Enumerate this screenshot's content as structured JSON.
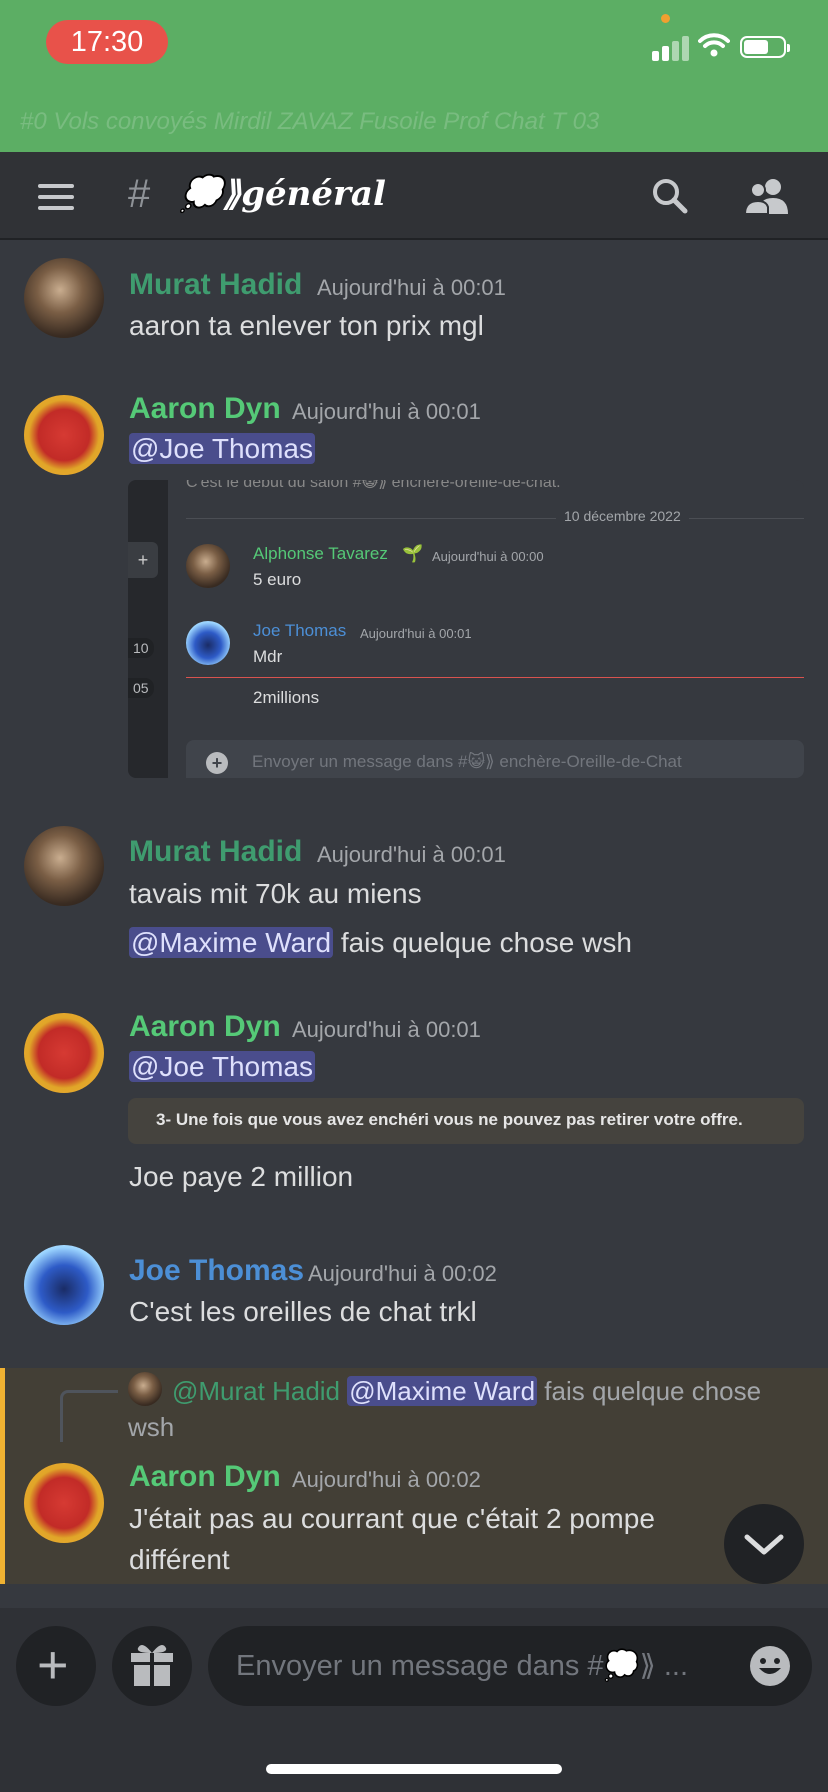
{
  "status_bar": {
    "time": "17:30",
    "bg_color": "#5cae64"
  },
  "header": {
    "hash": "#",
    "channel_name": "💭⟫général"
  },
  "messages": [
    {
      "author": "Murat Hadid",
      "timestamp": "Aujourd'hui à 00:01",
      "lines": [
        "aaron ta enlever ton prix mgl"
      ]
    },
    {
      "author": "Aaron Dyn",
      "timestamp": "Aujourd'hui à 00:01",
      "mention": "@Joe Thomas",
      "attachment": {
        "clipped_top": "C'est le début du salon #😺⟫ enchère-oreille-de-chat.",
        "date": "10 décembre 2022",
        "sidebar_counts": [
          "10",
          "05"
        ],
        "items": [
          {
            "author": "Alphonse Tavarez",
            "badge": "🌱",
            "timestamp": "Aujourd'hui à 00:00",
            "text": "5 euro"
          },
          {
            "author": "Joe Thomas",
            "timestamp": "Aujourd'hui à 00:01",
            "text": "Mdr"
          },
          {
            "text": "2millions"
          }
        ],
        "input_placeholder": "Envoyer un message dans #😺⟫ enchère-Oreille-de-Chat"
      }
    },
    {
      "author": "Murat Hadid",
      "timestamp": "Aujourd'hui à 00:01",
      "lines": [
        "tavais mit 70k au miens"
      ],
      "mention": "@Maxime Ward",
      "mention_suffix": " fais quelque chose wsh"
    },
    {
      "author": "Aaron Dyn",
      "timestamp": "Aujourd'hui à 00:01",
      "mention": "@Joe Thomas",
      "embed_rule": "3- Une fois que vous avez enchéri vous ne pouvez pas retirer votre offre.",
      "lines": [
        "Joe paye 2 million"
      ]
    },
    {
      "author": "Joe Thomas",
      "timestamp": "Aujourd'hui à 00:02",
      "lines": [
        "C'est les oreilles de chat trkl"
      ]
    },
    {
      "reply_to": {
        "author": "@Murat Hadid",
        "mention": "@Maxime Ward",
        "text": " fais quelque chose",
        "text_cont": "wsh"
      },
      "author": "Aaron Dyn",
      "timestamp": "Aujourd'hui à 00:02",
      "lines": [
        "J'était pas au courrant que c'était 2 pompe",
        "différent"
      ]
    }
  ],
  "composer": {
    "placeholder": "Envoyer un message dans #💭⟫ ..."
  },
  "colors": {
    "murat": "#3f9c6f",
    "aaron": "#55c977",
    "joe": "#4c8fd6",
    "highlight": "#f0b232"
  }
}
